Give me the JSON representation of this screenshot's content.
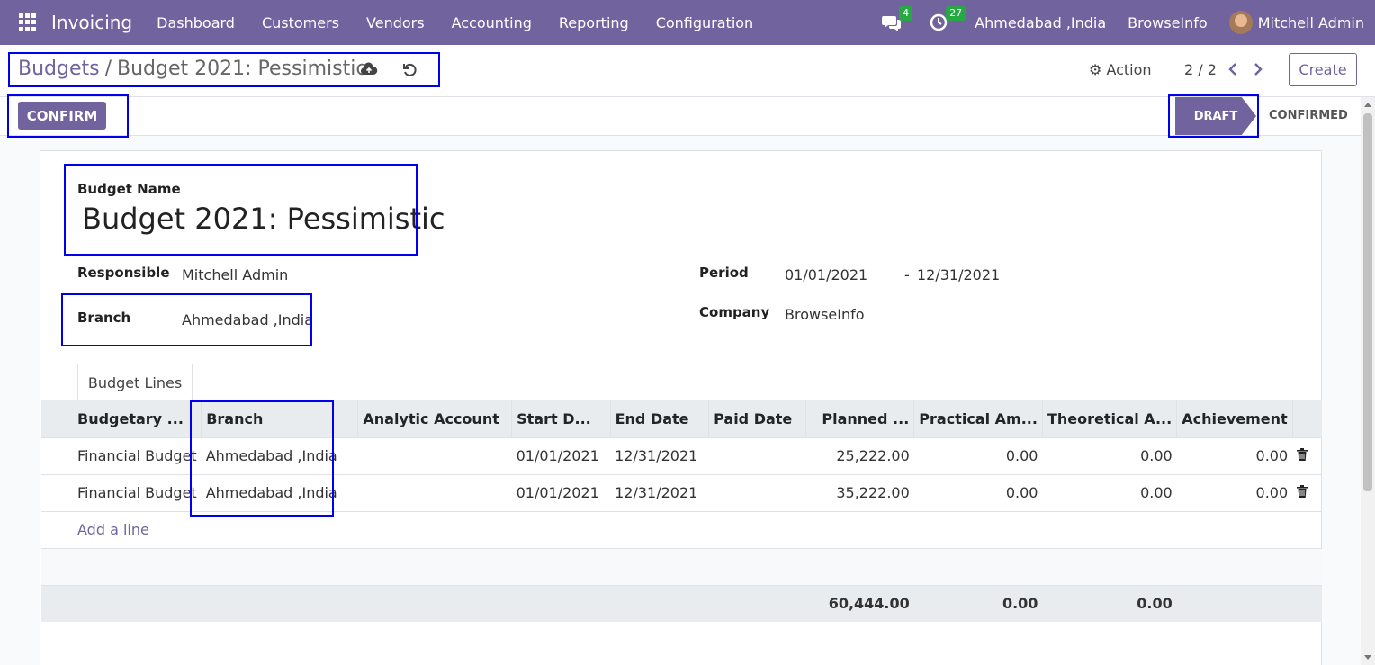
{
  "topbar": {
    "app_title": "Invoicing",
    "menu": [
      "Dashboard",
      "Customers",
      "Vendors",
      "Accounting",
      "Reporting",
      "Configuration"
    ],
    "messages_count": "4",
    "activities_count": "27",
    "branch": "Ahmedabad ,India",
    "company": "BrowseInfo",
    "user": "Mitchell Admin"
  },
  "control": {
    "breadcrumb_parent": "Budgets",
    "breadcrumb_sep": "/",
    "breadcrumb_current": "Budget 2021: Pessimistic",
    "action_label": "Action",
    "pager": "2 / 2",
    "create_label": "Create"
  },
  "statusbar": {
    "confirm_label": "CONFIRM",
    "stages": [
      "DRAFT",
      "CONFIRMED"
    ],
    "active_stage": "DRAFT"
  },
  "form": {
    "name_label": "Budget Name",
    "name_value": "Budget 2021: Pessimistic",
    "responsible_label": "Responsible",
    "responsible_value": "Mitchell Admin",
    "branch_label": "Branch",
    "branch_value": "Ahmedabad ,India",
    "period_label": "Period",
    "period_start": "01/01/2021",
    "period_sep": "-",
    "period_end": "12/31/2021",
    "company_label": "Company",
    "company_value": "BrowseInfo"
  },
  "tab_label": "Budget Lines",
  "lines": {
    "headers": [
      "Budgetary ...",
      "Branch",
      "Analytic Account",
      "Start D...",
      "End Date",
      "Paid Date",
      "Planned ...",
      "Practical Am...",
      "Theoretical A...",
      "Achievement"
    ],
    "rows": [
      [
        "Financial Budget",
        "Ahmedabad ,India",
        "",
        "01/01/2021",
        "12/31/2021",
        "",
        "25,222.00",
        "0.00",
        "0.00",
        "0.00"
      ],
      [
        "Financial Budget",
        "Ahmedabad ,India",
        "",
        "01/01/2021",
        "12/31/2021",
        "",
        "35,222.00",
        "0.00",
        "0.00",
        "0.00"
      ]
    ],
    "add_line": "Add a line",
    "totals": {
      "planned": "60,444.00",
      "practical": "0.00",
      "theoretical": "0.00"
    }
  },
  "colors": {
    "brand": "#71639e",
    "badge": "#28a745",
    "annotation": "#0000ee"
  }
}
